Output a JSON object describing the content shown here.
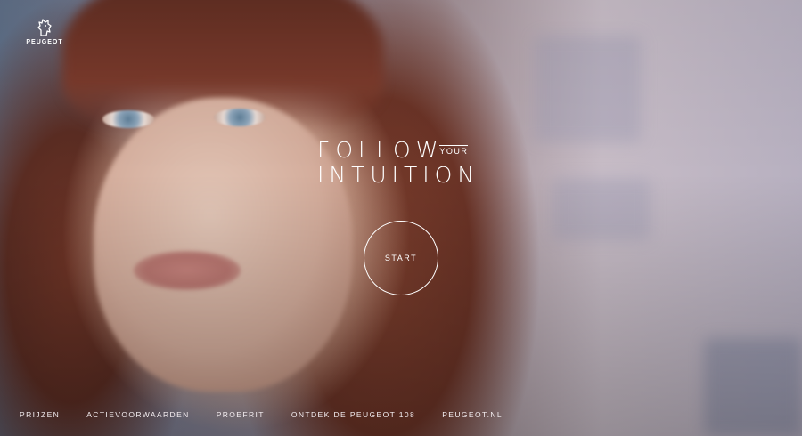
{
  "brand": {
    "name": "PEUGEOT",
    "logo_icon": "peugeot-lion-icon"
  },
  "headline": {
    "line1": "FOLLOW",
    "connector": "YOUR",
    "line2": "INTUITION"
  },
  "start_button": {
    "label": "START"
  },
  "footer_nav": {
    "items": [
      {
        "label": "PRIJZEN"
      },
      {
        "label": "ACTIEVOORWAARDEN"
      },
      {
        "label": "PROEFRIT"
      },
      {
        "label": "ONTDEK DE PEUGEOT 108"
      },
      {
        "label": "PEUGEOT.NL"
      }
    ]
  },
  "colors": {
    "text": "#ffffff",
    "hair": "#7a3d2c",
    "background_right": "#c7bcc6"
  }
}
